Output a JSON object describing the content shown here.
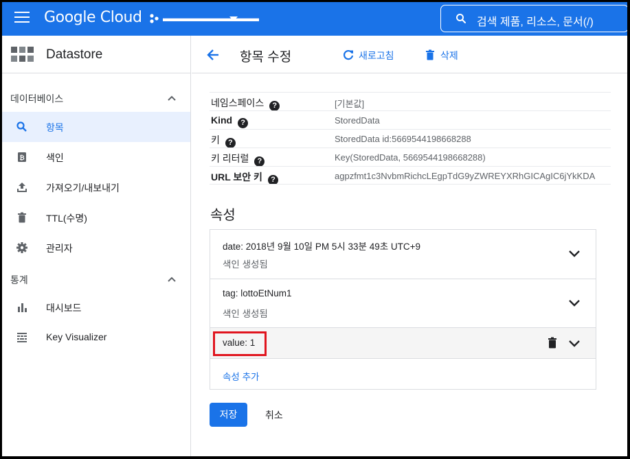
{
  "topbar": {
    "logo": "Google Cloud",
    "project_name": "▬▬▬▬▬▬▬▬▬▬",
    "search_text": "검색   제품, 리소스, 문서(/)"
  },
  "sidebar": {
    "product_title": "Datastore",
    "sections": [
      {
        "title": "데이터베이스",
        "items": [
          {
            "label": "항목",
            "icon": "search-icon",
            "active": true
          },
          {
            "label": "색인",
            "icon": "index-icon",
            "active": false
          },
          {
            "label": "가져오기/내보내기",
            "icon": "upload-icon",
            "active": false
          },
          {
            "label": "TTL(수명)",
            "icon": "trash-icon",
            "active": false
          },
          {
            "label": "관리자",
            "icon": "gear-icon",
            "active": false
          }
        ]
      },
      {
        "title": "통계",
        "items": [
          {
            "label": "대시보드",
            "icon": "bar-chart-icon",
            "active": false
          },
          {
            "label": "Key Visualizer",
            "icon": "heatmap-icon",
            "active": false
          }
        ]
      }
    ]
  },
  "header": {
    "title": "항목 수정",
    "refresh_label": "새로고침",
    "delete_label": "삭제"
  },
  "entity": {
    "rows": [
      {
        "key": "네임스페이스",
        "value": "[기본값]",
        "bold": false
      },
      {
        "key": "Kind",
        "value": "StoredData",
        "bold": true
      },
      {
        "key": "키",
        "value": "StoredData id:5669544198668288",
        "bold": false
      },
      {
        "key": "키 리터럴",
        "value": "Key(StoredData, 5669544198668288)",
        "bold": false
      },
      {
        "key": "URL 보안 키",
        "value": "agpzfmt1c3NvbmRichcLEgpTdG9yZWREYXRhGICAgIC6jYkKDA",
        "bold": true
      }
    ]
  },
  "properties": {
    "title": "속성",
    "items": [
      {
        "text": "date:  2018년 9월 10일 PM 5시 33분 49초 UTC+9",
        "sub": "색인 생성됨"
      },
      {
        "text": "tag:  lottoEtNum1",
        "sub": "색인 생성됨"
      },
      {
        "text": "value:  1",
        "sub": ""
      }
    ],
    "add_label": "속성 추가"
  },
  "actions": {
    "save_label": "저장",
    "cancel_label": "취소"
  },
  "colors": {
    "brand_blue": "#1a73e8",
    "highlight_red": "#e0141e"
  }
}
